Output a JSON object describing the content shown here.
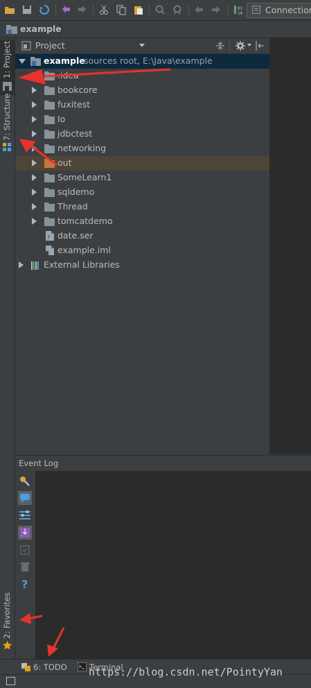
{
  "toolbar": {
    "connection_label": "Connection"
  },
  "breadcrumb": {
    "label": "example"
  },
  "left_stripe": {
    "project_tab": "1: Project",
    "structure_tab": "7: Structure",
    "favorites_tab": "2: Favorites"
  },
  "project_panel": {
    "view_label": "Project",
    "root": {
      "label": "example",
      "suffix": "sources root,  E:\\Java\\example"
    },
    "items": [
      {
        "label": ".idea",
        "kind": "folder"
      },
      {
        "label": "bookcore",
        "kind": "folder"
      },
      {
        "label": "fuxitest",
        "kind": "folder"
      },
      {
        "label": "Io",
        "kind": "folder"
      },
      {
        "label": "jdbctest",
        "kind": "folder"
      },
      {
        "label": "networking",
        "kind": "folder"
      },
      {
        "label": "out",
        "kind": "folder-orange"
      },
      {
        "label": "SomeLearn1",
        "kind": "folder"
      },
      {
        "label": "sqldemo",
        "kind": "folder"
      },
      {
        "label": "Thread",
        "kind": "folder"
      },
      {
        "label": "tomcatdemo",
        "kind": "folder"
      },
      {
        "label": "date.ser",
        "kind": "file"
      },
      {
        "label": "example.iml",
        "kind": "file"
      }
    ],
    "external_libraries": "External Libraries"
  },
  "event_log": {
    "title": "Event Log"
  },
  "bottom_tabs": {
    "todo": "6: TODO",
    "terminal": "Terminal"
  },
  "watermark": "https://blog.csdn.net/PointyYan",
  "colors": {
    "selection": "#0d293e",
    "highlight_row": "#4e4536",
    "annotation_arrow": "#e8322d",
    "favorites_star": "#e5a21b"
  }
}
